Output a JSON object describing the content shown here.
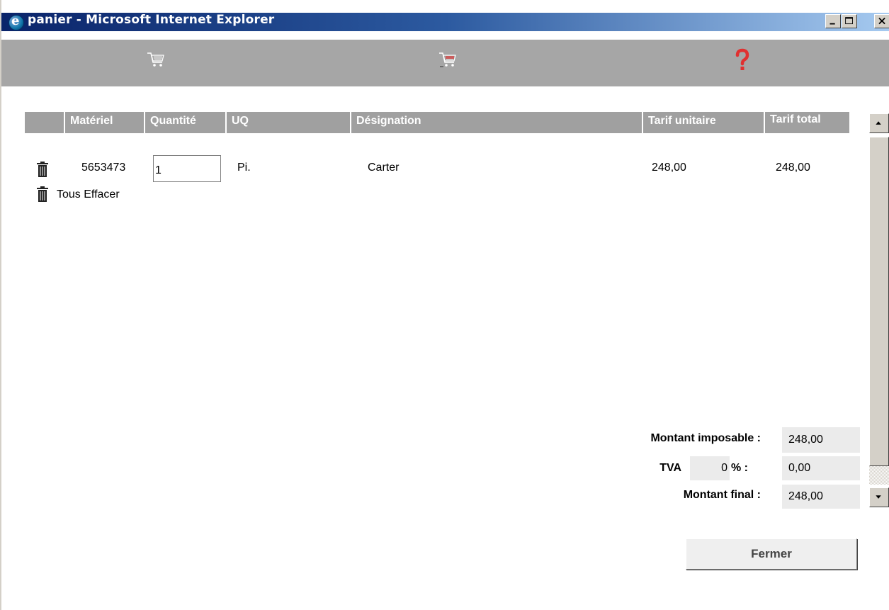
{
  "window": {
    "title": "panier - Microsoft Internet Explorer"
  },
  "toolbar": {
    "icons": [
      "cart-icon",
      "cart-checkout-icon",
      "help-icon"
    ],
    "help_color": "#e03030"
  },
  "table": {
    "headers": [
      "Matériel",
      "Quantité",
      "UQ",
      "Désignation",
      "Tarif unitaire",
      "Tarif total"
    ],
    "rows": [
      {
        "materiel": "5653473",
        "quantite": "1",
        "uq": "Pi.",
        "designation": "Carter",
        "tarif_unitaire": "248,00",
        "tarif_total": "248,00"
      }
    ],
    "clear_all_label": "Tous Effacer"
  },
  "totals": {
    "montant_imposable_label": "Montant imposable :",
    "montant_imposable_value": "248,00",
    "tva_label": "TVA",
    "tva_rate": "0",
    "tva_percent_label": "% :",
    "tva_value": "0,00",
    "montant_final_label": "Montant final :",
    "montant_final_value": "248,00"
  },
  "actions": {
    "close_label": "Fermer"
  },
  "colors": {
    "header_bg": "#a0a0a0",
    "toolbar_bg": "#a6a6a6",
    "titlebar_start": "#0a246a",
    "titlebar_end": "#a6caf0"
  }
}
